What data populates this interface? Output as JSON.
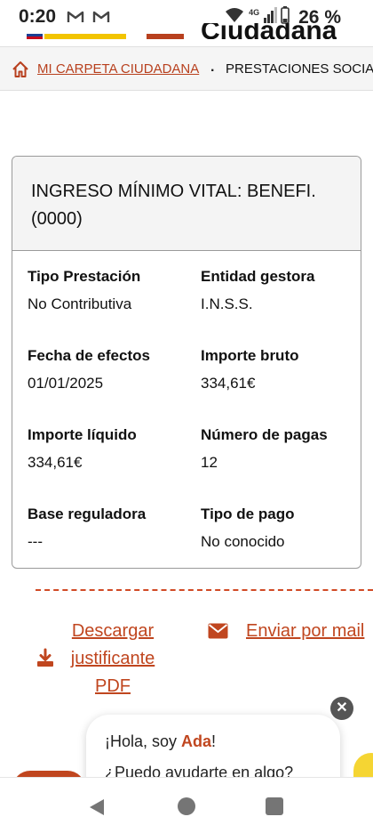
{
  "status_bar": {
    "time": "0:20",
    "notification_icons": [
      "gmail-icon",
      "gmail-icon"
    ],
    "network": "4G",
    "battery": "26 %"
  },
  "header": {
    "logo_text": "Ciudadana"
  },
  "breadcrumb": {
    "home_icon": "home-icon",
    "link": "MI CARPETA CIUDADANA",
    "separator": ".",
    "current": "PRESTACIONES SOCIALES"
  },
  "card": {
    "title": "INGRESO MÍNIMO VITAL: BENEFI. (0000)",
    "fields": [
      {
        "label": "Tipo Prestación",
        "value": "No Contributiva"
      },
      {
        "label": "Entidad gestora",
        "value": "I.N.S.S."
      },
      {
        "label": "Fecha de efectos",
        "value": "01/01/2025"
      },
      {
        "label": "Importe bruto",
        "value": "334,61€"
      },
      {
        "label": "Importe líquido",
        "value": "334,61€"
      },
      {
        "label": "Número de pagas",
        "value": "12"
      },
      {
        "label": "Base reguladora",
        "value": "---"
      },
      {
        "label": "Tipo de pago",
        "value": "No conocido"
      }
    ]
  },
  "actions": {
    "download_label": "Descargar justificante PDF",
    "mail_label": "Enviar por mail"
  },
  "chat": {
    "greeting_prefix": "¡Hola, soy ",
    "assistant_name": "Ada",
    "greeting_suffix": "!",
    "question": "¿Puedo ayudarte en algo?",
    "close_symbol": "✕"
  },
  "colors": {
    "accent": "#c0461f",
    "card_header_bg": "#f4f4f4",
    "border": "#9a9a9a",
    "nav_icon": "#757575"
  }
}
